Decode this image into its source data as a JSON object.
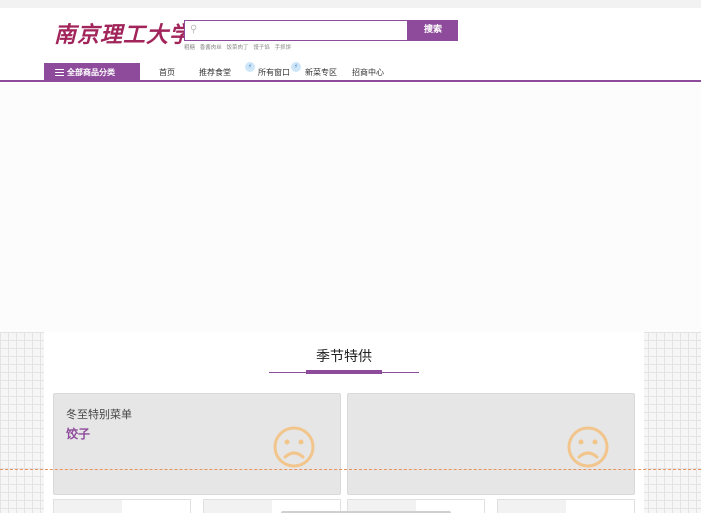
{
  "header": {
    "logo_text": "南京理工大学",
    "search": {
      "placeholder": "",
      "button_label": "搜索"
    },
    "hot_words": [
      "粗糖",
      "香酱肉丝",
      "饭菜肉丁",
      "馒子馅",
      "手抓饼"
    ]
  },
  "nav": {
    "category_label": "全部商品分类",
    "items": [
      {
        "label": "首页"
      },
      {
        "label": "推荐食堂"
      },
      {
        "label": "所有窗口"
      },
      {
        "label": "新菜专区"
      },
      {
        "label": "招商中心"
      }
    ],
    "bubble_glyph": "⚡"
  },
  "section": {
    "title": "季节特供",
    "cards": [
      {
        "line1": "冬至特别菜单",
        "line2": "饺子",
        "icon": "sad-face-icon"
      },
      {
        "line1": "",
        "line2": "",
        "icon": "sad-face-icon"
      }
    ]
  },
  "colors": {
    "brand": "#8e4b9c",
    "logo": "#a1245a",
    "icon_face": "#f2c58c",
    "dashed_guide": "#e8925c"
  }
}
